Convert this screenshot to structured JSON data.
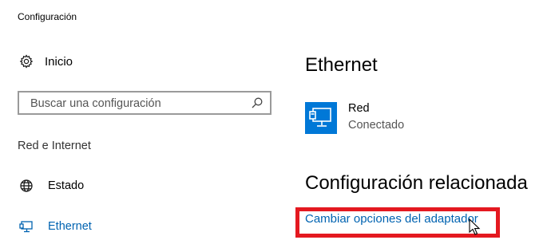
{
  "window": {
    "title": "Configuración"
  },
  "sidebar": {
    "home_label": "Inicio",
    "search": {
      "placeholder": "Buscar una configuración",
      "value": ""
    },
    "section_header": "Red e Internet",
    "items": [
      {
        "label": "Estado",
        "icon": "globe-icon",
        "selected": false
      },
      {
        "label": "Ethernet",
        "icon": "ethernet-icon",
        "selected": true
      }
    ]
  },
  "main": {
    "page_title": "Ethernet",
    "network": {
      "name": "Red",
      "status": "Conectado",
      "icon": "network-monitor-icon"
    },
    "related": {
      "title": "Configuración relacionada",
      "link_label": "Cambiar opciones del adaptador"
    }
  },
  "colors": {
    "accent": "#0078d7",
    "link": "#0063b1",
    "highlight_frame": "#e41920"
  }
}
